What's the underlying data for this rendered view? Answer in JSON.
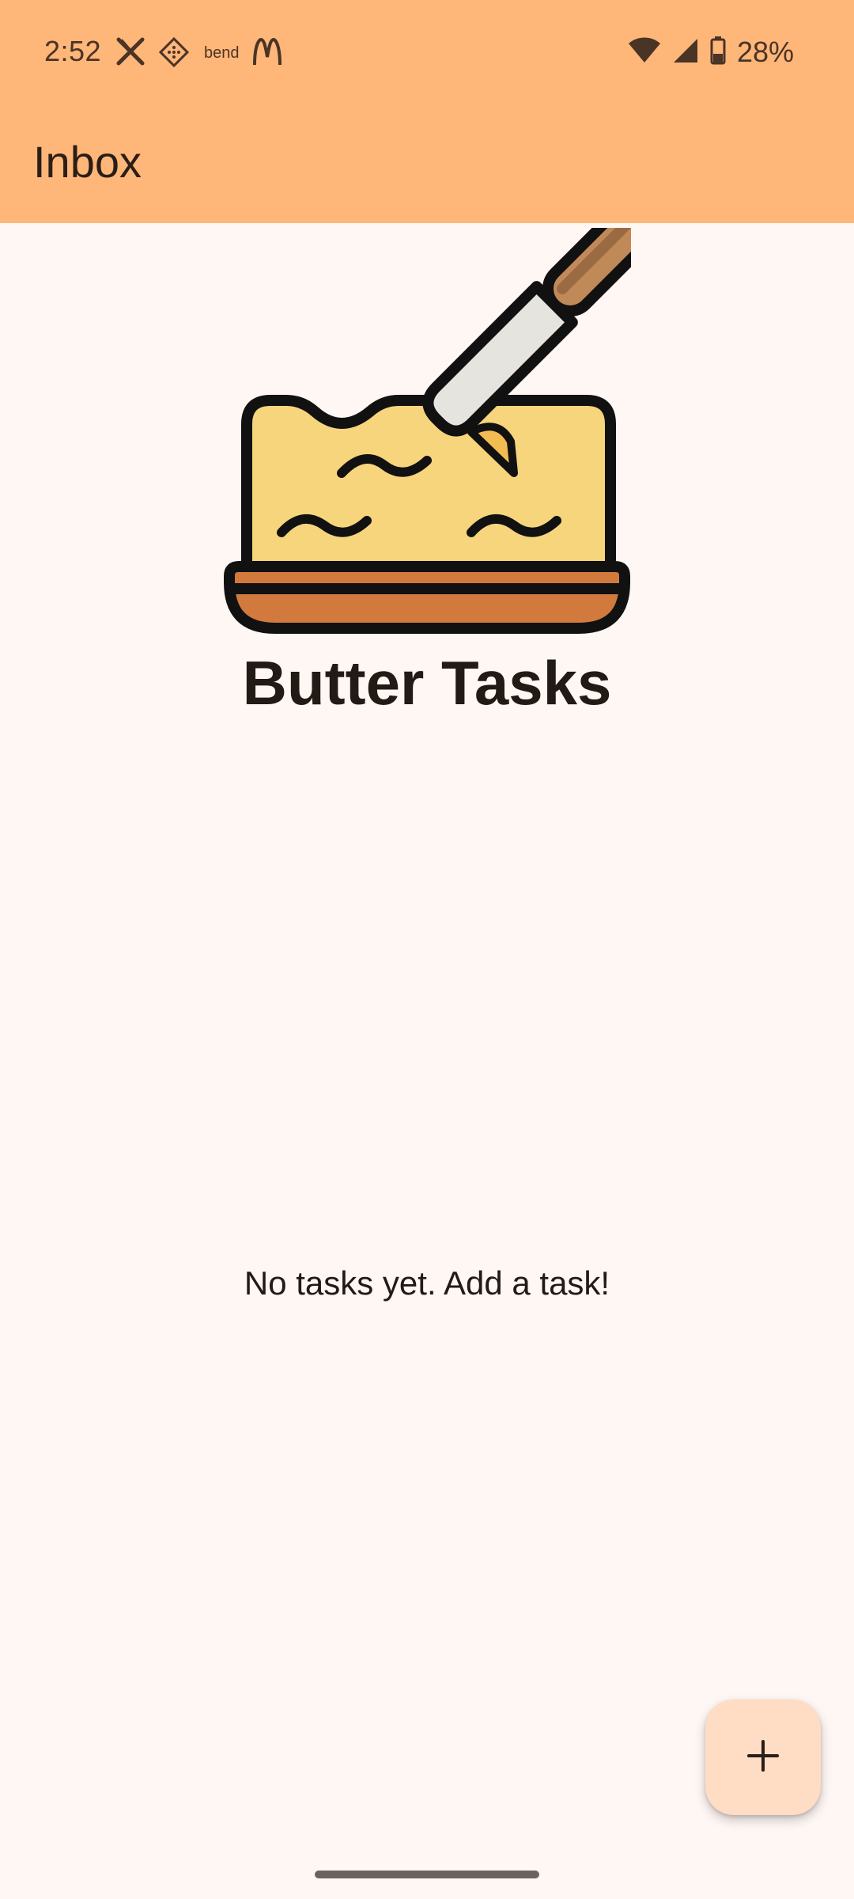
{
  "status_bar": {
    "time": "2:52",
    "notification_icons": [
      "x-icon",
      "diamond-app-icon",
      "bend-icon",
      "mcdonalds-icon"
    ],
    "bend_label": "bend",
    "wifi_icon": "wifi-icon",
    "signal_icon": "signal-icon",
    "battery_icon": "battery-icon",
    "battery_percent": "28%"
  },
  "app_bar": {
    "title": "Inbox"
  },
  "header": {
    "brand": "Butter Tasks",
    "logo_icon": "butter-dish-icon"
  },
  "main": {
    "empty_message": "No tasks yet. Add a task!"
  },
  "fab": {
    "icon": "plus-icon"
  },
  "colors": {
    "top_bar": "#FFB679",
    "background": "#FFF7F4",
    "fab": "#FFDCC4",
    "butter": "#F7D57D",
    "dish": "#D27A3E",
    "handle": "#C08A58"
  }
}
